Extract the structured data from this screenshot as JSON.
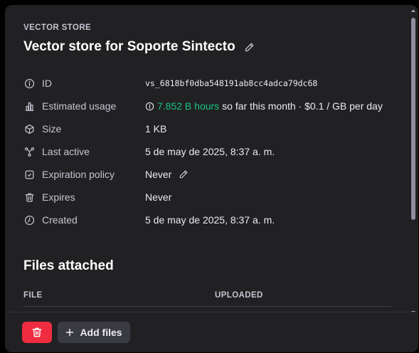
{
  "header": {
    "eyebrow": "VECTOR STORE",
    "title": "Vector store for Soporte Sintecto"
  },
  "details": {
    "id": {
      "label": "ID",
      "value": "vs_6818bf0dba548191ab8cc4adca79dc68",
      "icon": "info-icon"
    },
    "usage": {
      "label": "Estimated usage",
      "amount": "7.852 B hours",
      "suffix": "so far this month · $0.1 / GB per day",
      "icon": "bar-chart-icon"
    },
    "size": {
      "label": "Size",
      "value": "1 KB",
      "icon": "cube-icon"
    },
    "last_active": {
      "label": "Last active",
      "value": "5 de may de 2025, 8:37 a. m.",
      "icon": "nodes-icon"
    },
    "expiration_policy": {
      "label": "Expiration policy",
      "value": "Never",
      "icon": "calendar-clock-icon"
    },
    "expires": {
      "label": "Expires",
      "value": "Never",
      "icon": "trash-icon"
    },
    "created": {
      "label": "Created",
      "value": "5 de may de 2025, 8:37 a. m.",
      "icon": "clock-icon"
    }
  },
  "files": {
    "title": "Files attached",
    "columns": [
      "FILE",
      "UPLOADED"
    ]
  },
  "footer": {
    "add_files_label": "Add files"
  },
  "colors": {
    "accent_green": "#19c37d",
    "danger": "#ef2c40",
    "panel_bg": "#212123"
  }
}
